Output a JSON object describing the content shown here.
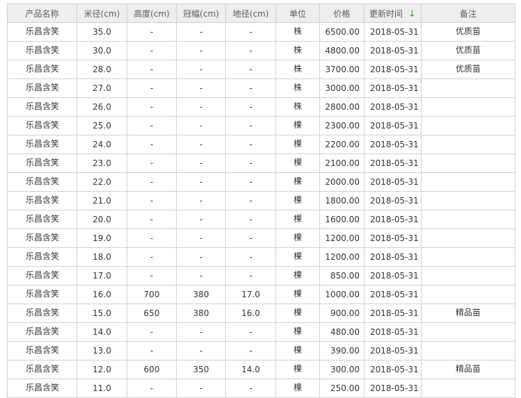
{
  "headers": {
    "name": "产品名称",
    "diameter": "米径(cm)",
    "height": "高度(cm)",
    "crown": "冠幅(cm)",
    "ground": "地径(cm)",
    "unit": "单位",
    "price": "价格",
    "updated": "更新时间",
    "remark": "备注"
  },
  "sort_icon": "arrow-down-icon",
  "accent_color": "#2e9e2e",
  "rows": [
    {
      "name": "乐昌含笑",
      "diameter": "35.0",
      "height": "-",
      "crown": "-",
      "ground": "-",
      "unit": "株",
      "price": "6500.00",
      "updated": "2018-05-31",
      "remark": "优质苗"
    },
    {
      "name": "乐昌含笑",
      "diameter": "30.0",
      "height": "-",
      "crown": "-",
      "ground": "-",
      "unit": "株",
      "price": "4800.00",
      "updated": "2018-05-31",
      "remark": "优质苗"
    },
    {
      "name": "乐昌含笑",
      "diameter": "28.0",
      "height": "-",
      "crown": "-",
      "ground": "-",
      "unit": "株",
      "price": "3700.00",
      "updated": "2018-05-31",
      "remark": "优质苗"
    },
    {
      "name": "乐昌含笑",
      "diameter": "27.0",
      "height": "-",
      "crown": "-",
      "ground": "-",
      "unit": "株",
      "price": "3000.00",
      "updated": "2018-05-31",
      "remark": ""
    },
    {
      "name": "乐昌含笑",
      "diameter": "26.0",
      "height": "-",
      "crown": "-",
      "ground": "-",
      "unit": "株",
      "price": "2800.00",
      "updated": "2018-05-31",
      "remark": ""
    },
    {
      "name": "乐昌含笑",
      "diameter": "25.0",
      "height": "-",
      "crown": "-",
      "ground": "-",
      "unit": "棵",
      "price": "2300.00",
      "updated": "2018-05-31",
      "remark": ""
    },
    {
      "name": "乐昌含笑",
      "diameter": "24.0",
      "height": "-",
      "crown": "-",
      "ground": "-",
      "unit": "棵",
      "price": "2200.00",
      "updated": "2018-05-31",
      "remark": ""
    },
    {
      "name": "乐昌含笑",
      "diameter": "23.0",
      "height": "-",
      "crown": "-",
      "ground": "-",
      "unit": "棵",
      "price": "2100.00",
      "updated": "2018-05-31",
      "remark": ""
    },
    {
      "name": "乐昌含笑",
      "diameter": "22.0",
      "height": "-",
      "crown": "-",
      "ground": "-",
      "unit": "棵",
      "price": "2000.00",
      "updated": "2018-05-31",
      "remark": ""
    },
    {
      "name": "乐昌含笑",
      "diameter": "21.0",
      "height": "-",
      "crown": "-",
      "ground": "-",
      "unit": "棵",
      "price": "1800.00",
      "updated": "2018-05-31",
      "remark": ""
    },
    {
      "name": "乐昌含笑",
      "diameter": "20.0",
      "height": "-",
      "crown": "-",
      "ground": "-",
      "unit": "棵",
      "price": "1600.00",
      "updated": "2018-05-31",
      "remark": ""
    },
    {
      "name": "乐昌含笑",
      "diameter": "19.0",
      "height": "-",
      "crown": "-",
      "ground": "-",
      "unit": "棵",
      "price": "1200.00",
      "updated": "2018-05-31",
      "remark": ""
    },
    {
      "name": "乐昌含笑",
      "diameter": "18.0",
      "height": "-",
      "crown": "-",
      "ground": "-",
      "unit": "棵",
      "price": "1200.00",
      "updated": "2018-05-31",
      "remark": ""
    },
    {
      "name": "乐昌含笑",
      "diameter": "17.0",
      "height": "-",
      "crown": "-",
      "ground": "-",
      "unit": "棵",
      "price": "850.00",
      "updated": "2018-05-31",
      "remark": ""
    },
    {
      "name": "乐昌含笑",
      "diameter": "16.0",
      "height": "700",
      "crown": "380",
      "ground": "17.0",
      "unit": "棵",
      "price": "1000.00",
      "updated": "2018-05-31",
      "remark": ""
    },
    {
      "name": "乐昌含笑",
      "diameter": "15.0",
      "height": "650",
      "crown": "380",
      "ground": "16.0",
      "unit": "棵",
      "price": "900.00",
      "updated": "2018-05-31",
      "remark": "精品苗"
    },
    {
      "name": "乐昌含笑",
      "diameter": "14.0",
      "height": "-",
      "crown": "-",
      "ground": "-",
      "unit": "棵",
      "price": "480.00",
      "updated": "2018-05-31",
      "remark": ""
    },
    {
      "name": "乐昌含笑",
      "diameter": "13.0",
      "height": "-",
      "crown": "-",
      "ground": "-",
      "unit": "棵",
      "price": "390.00",
      "updated": "2018-05-31",
      "remark": ""
    },
    {
      "name": "乐昌含笑",
      "diameter": "12.0",
      "height": "600",
      "crown": "350",
      "ground": "14.0",
      "unit": "棵",
      "price": "300.00",
      "updated": "2018-05-31",
      "remark": "精品苗"
    },
    {
      "name": "乐昌含笑",
      "diameter": "11.0",
      "height": "-",
      "crown": "-",
      "ground": "-",
      "unit": "棵",
      "price": "250.00",
      "updated": "2018-05-31",
      "remark": ""
    }
  ]
}
